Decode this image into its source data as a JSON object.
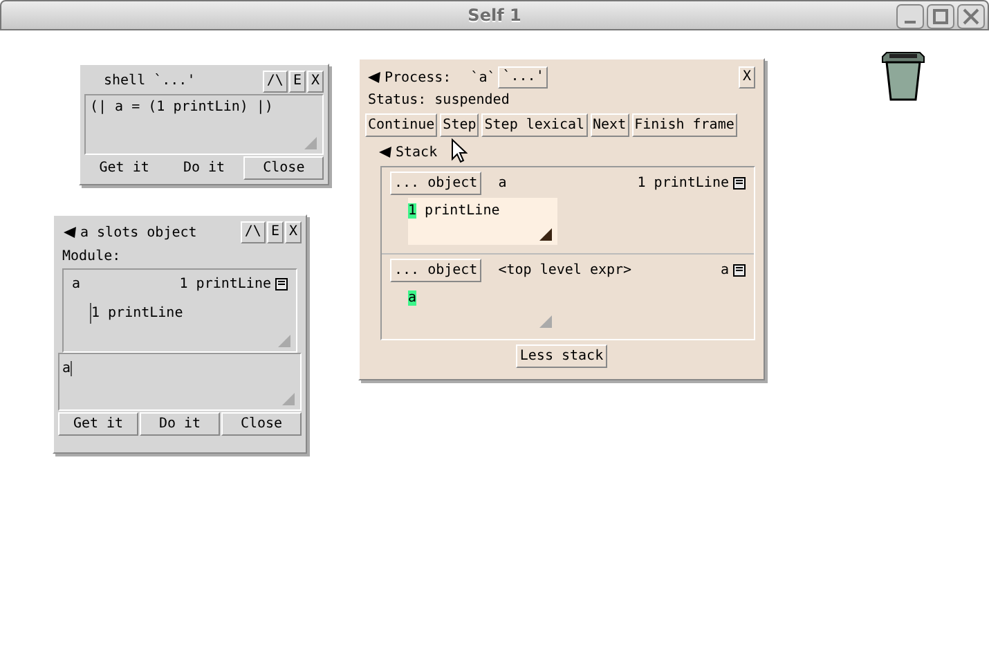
{
  "window": {
    "title": "Self 1"
  },
  "shell": {
    "title": "shell `...'",
    "title_buttons": [
      "/\\",
      "E",
      "X"
    ],
    "code": "(| a = (1 printLin) |)",
    "buttons": [
      {
        "label": "Get it",
        "raised": false
      },
      {
        "label": "Do it",
        "raised": false
      },
      {
        "label": "Close",
        "raised": true
      }
    ]
  },
  "slots_object": {
    "title": "a slots object",
    "title_buttons": [
      "/\\",
      "E",
      "X"
    ],
    "module": "Module:",
    "slot": {
      "name": "a",
      "value": "1 printLine"
    },
    "slot_body": "1 printLine",
    "evaluator": "a",
    "buttons": [
      {
        "label": "Get it",
        "raised": true
      },
      {
        "label": "Do it",
        "raised": true
      },
      {
        "label": "Close",
        "raised": true
      }
    ]
  },
  "process": {
    "title": "Process:",
    "receiver": "`a`",
    "more": "`...'",
    "close": "X",
    "status": "Status: suspended",
    "buttons": [
      "Continue",
      "Step",
      "Step lexical",
      "Next",
      "Finish frame"
    ],
    "stack_label": "Stack",
    "frames": [
      {
        "receiver": "... object",
        "selector": "a",
        "value": "1 printLine",
        "highlight": "1",
        "rest": " printLine",
        "active": true
      },
      {
        "receiver": "... object",
        "selector": "<top level expr>",
        "value": "a",
        "highlight": "a",
        "active": false
      }
    ],
    "less": "Less stack"
  }
}
